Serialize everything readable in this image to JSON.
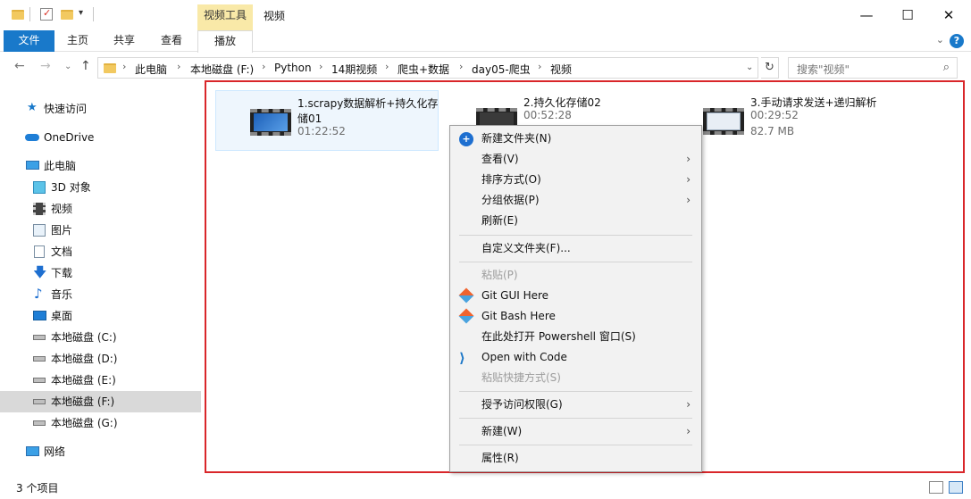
{
  "window": {
    "title": "视频",
    "context_tab_group": "视频工具",
    "minimize_glyph": "—",
    "maximize_glyph": "☐",
    "close_glyph": "✕"
  },
  "ribbon": {
    "tabs": [
      "文件",
      "主页",
      "共享",
      "查看"
    ],
    "context_tab": "播放",
    "collapse_glyph": "⌄",
    "help_glyph": "?"
  },
  "address": {
    "back_glyph": "←",
    "forward_glyph": "→",
    "dropdown_glyph": "⌄",
    "up_glyph": "↑",
    "crumbs": [
      "此电脑",
      "本地磁盘 (F:)",
      "Python",
      "14期视频",
      "爬虫+数据",
      "day05-爬虫",
      "视频"
    ],
    "crumb_sep": "›",
    "addr_dropdown": "⌄",
    "refresh_glyph": "↻",
    "search_placeholder": "搜索\"视频\"",
    "search_glyph": "⌕"
  },
  "nav": {
    "items": [
      {
        "label": "快速访问",
        "icon": "star-icon"
      },
      {
        "label": "OneDrive",
        "icon": "cloud-icon"
      },
      {
        "label": "此电脑",
        "icon": "computer-icon"
      },
      {
        "label": "3D 对象",
        "icon": "cube-icon"
      },
      {
        "label": "视频",
        "icon": "film-icon"
      },
      {
        "label": "图片",
        "icon": "picture-icon"
      },
      {
        "label": "文档",
        "icon": "document-icon"
      },
      {
        "label": "下载",
        "icon": "download-icon"
      },
      {
        "label": "音乐",
        "icon": "music-icon"
      },
      {
        "label": "桌面",
        "icon": "desktop-icon"
      },
      {
        "label": "本地磁盘 (C:)",
        "icon": "drive-icon"
      },
      {
        "label": "本地磁盘 (D:)",
        "icon": "drive-icon"
      },
      {
        "label": "本地磁盘 (E:)",
        "icon": "drive-icon"
      },
      {
        "label": "本地磁盘 (F:)",
        "icon": "drive-icon"
      },
      {
        "label": "本地磁盘 (G:)",
        "icon": "drive-icon"
      },
      {
        "label": "网络",
        "icon": "network-icon"
      }
    ],
    "selected": "本地磁盘 (F:)"
  },
  "files": [
    {
      "name": "1.scrapy数据解析+持久化存储01",
      "duration": "01:22:52",
      "size": ""
    },
    {
      "name": "2.持久化存储02",
      "duration": "00:52:28",
      "size": ""
    },
    {
      "name": "3.手动请求发送+递归解析",
      "duration": "00:29:52",
      "size": "82.7 MB"
    }
  ],
  "context_menu": {
    "submenu_arrow": "›",
    "new_folder": "新建文件夹(N)",
    "view": "查看(V)",
    "sort_by": "排序方式(O)",
    "group_by": "分组依据(P)",
    "refresh": "刷新(E)",
    "customize": "自定义文件夹(F)...",
    "paste": "粘贴(P)",
    "git_gui": "Git GUI Here",
    "git_bash": "Git Bash Here",
    "powershell": "在此处打开 Powershell 窗口(S)",
    "open_code": "Open with Code",
    "paste_shortcut": "粘贴快捷方式(S)",
    "grant_access": "授予访问权限(G)",
    "new": "新建(W)",
    "properties": "属性(R)"
  },
  "status": {
    "item_count": "3 个项目"
  },
  "colors": {
    "accent": "#1979ca",
    "highlight_frame": "#d9262a",
    "context_tab": "#f9e9a8"
  }
}
